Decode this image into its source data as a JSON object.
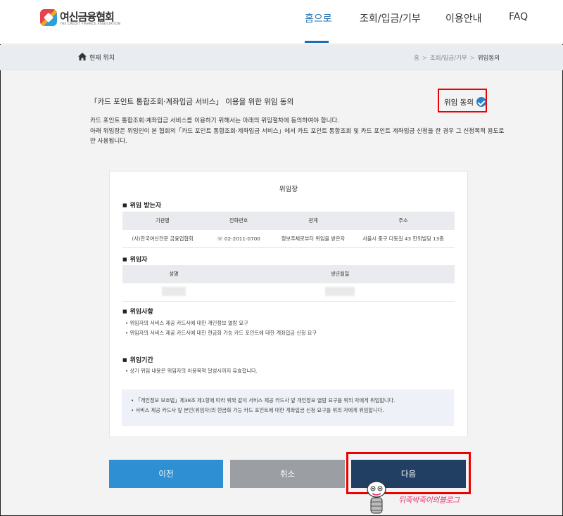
{
  "header": {
    "logo": {
      "name": "여신금융협회",
      "subtitle": "THE CREDIT FINANCE ASSOCIATION"
    },
    "nav": [
      {
        "label": "홈으로",
        "active": true
      },
      {
        "label": "조회/입금/기부"
      },
      {
        "label": "이용안내"
      },
      {
        "label": "FAQ"
      }
    ]
  },
  "breadcrumb": {
    "location_label": "현재 위치",
    "trail": [
      "홈",
      "조회/입금/기부",
      "위임동의"
    ]
  },
  "intro": {
    "title": "「카드 포인트 통합조회·계좌입금 서비스」 이용을 위한 위임 동의",
    "consent_label": "위임 동의",
    "lines": [
      "카드 포인트 통합조회·계좌입금 서비스를 이용하기 위해서는 아래의 위임절차에 동의하여야 합니다.",
      "아래 위임장은 위임인이 본 협회의「카드 포인트 통합조회·계좌입금 서비스」에서 카드 포인트 통합조회 및 카드 포인트 계좌입금 신청을 한 경우 그 신청목적 용도로만 사용됩니다."
    ]
  },
  "letter": {
    "title": "위임장",
    "recipient": {
      "heading": "위임 받는자",
      "columns": [
        "기관명",
        "전화번호",
        "관계",
        "주소"
      ],
      "row": [
        "(사)한국여신전문 금융업협회",
        "02-2011-0700",
        "정보주체로부터 위임을 받은자",
        "서울시 중구 다동길 43 한외빌딩 13층"
      ]
    },
    "delegator": {
      "heading": "위임자",
      "columns": [
        "성명",
        "생년월일"
      ]
    },
    "matters": {
      "heading": "위임사항",
      "items": [
        "위임자의 서비스 제공 카드사에 대한 개인정보 열람 요구",
        "위임자의 서비스 제공 카드사에 대한 현금화 가능 카드 포인트에 대한 계좌입금 신청 요구"
      ]
    },
    "period": {
      "heading": "위임기간",
      "items": [
        "상기 위임 내용은 위임자의 이용목적 달성시까지 유효합니다."
      ]
    },
    "note": [
      "「개인정보 보호법」제38조 제1항에 따라 위와 같이 서비스 제공 카드사 앞 개인정보 열람 요구를 위의 자에게 위임합니다.",
      "서비스 제공 카드사 앞 본인(위임자)의 현금화 가능 카드 포인트에 대한 계좌입금 신청 요구를 위의 자에게 위임합니다."
    ]
  },
  "buttons": {
    "prev": "이전",
    "cancel": "취소",
    "next": "다음"
  },
  "watermark": "뒤죽박죽이의블로그",
  "colors": {
    "accent": "#1c6db5",
    "prev": "#2e8fd3",
    "cancel": "#9b9fa4",
    "next": "#213f63",
    "highlight": "#e00000"
  }
}
